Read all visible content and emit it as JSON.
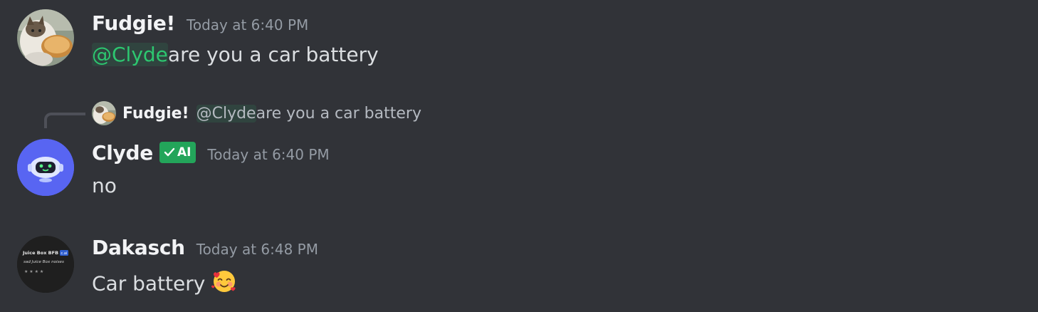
{
  "messages": [
    {
      "author": "Fudgie!",
      "timestamp": "Today at 6:40 PM",
      "mention": "@Clyde",
      "text": "are you a car battery",
      "avatar_icon": "cat-eating-toast-avatar"
    },
    {
      "reply": {
        "author": "Fudgie!",
        "mention": "@Clyde",
        "text": "are you a car battery"
      },
      "author": "Clyde",
      "badge": "AI",
      "timestamp": "Today at 6:40 PM",
      "text": "no",
      "avatar_icon": "clyde-robot-avatar",
      "avatar_color": "#5865f2",
      "badge_color": "#23a55a"
    },
    {
      "author": "Dakasch",
      "timestamp": "Today at 6:48 PM",
      "text": "Car battery",
      "emoji": "smiling-face-with-hearts-emoji",
      "avatar_icon": "juice-box-avatar",
      "avatar_text": {
        "title": "Juice Box BFB",
        "tag": "c.ai",
        "subtitle": "sad Juice Box noises",
        "stars": "★ ★ ★ ★"
      }
    }
  ],
  "colors": {
    "background": "#313338",
    "mention": "#2dc770",
    "username": "#f2f3f5",
    "timestamp": "#949ba4"
  }
}
